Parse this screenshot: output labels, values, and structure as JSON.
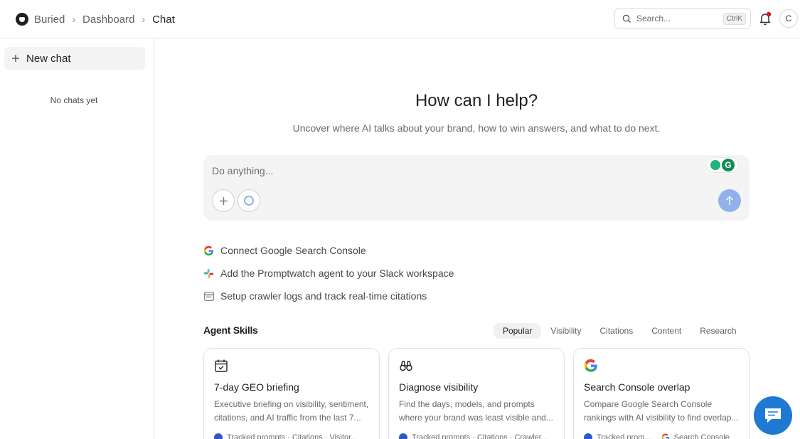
{
  "header": {
    "breadcrumb": [
      "Buried",
      "Dashboard",
      "Chat"
    ],
    "search_placeholder": "Search...",
    "search_shortcut": "CtrlK",
    "avatar_initial": "C"
  },
  "sidebar": {
    "new_chat_label": "New chat",
    "empty_text": "No chats yet"
  },
  "main": {
    "title": "How can I help?",
    "subtitle": "Uncover where AI talks about your brand, how to win answers, and what to do next.",
    "input_placeholder": "Do anything...",
    "quick_actions": [
      {
        "label": "Connect Google Search Console",
        "icon": "google-icon"
      },
      {
        "label": "Add the Promptwatch agent to your Slack workspace",
        "icon": "slack-icon"
      },
      {
        "label": "Setup crawler logs and track real-time citations",
        "icon": "terminal-icon"
      }
    ],
    "skills_title": "Agent Skills",
    "tabs": [
      "Popular",
      "Visibility",
      "Citations",
      "Content",
      "Research"
    ],
    "active_tab": "Popular",
    "cards": [
      {
        "icon": "calendar-check-icon",
        "title": "7-day GEO briefing",
        "desc": "Executive briefing on visibility, sentiment, citations, and AI traffic from the last 7...",
        "foot": "Tracked prompts · Citations · Visitor..."
      },
      {
        "icon": "binoculars-icon",
        "title": "Diagnose visibility",
        "desc": "Find the days, models, and prompts where your brand was least visible and...",
        "foot": "Tracked prompts · Citations · Crawler..."
      },
      {
        "icon": "google-icon",
        "title": "Search Console overlap",
        "desc": "Compare Google Search Console rankings with AI visibility to find overlap...",
        "foot": "Tracked prom...",
        "foot2": "Search Console"
      }
    ]
  },
  "colors": {
    "accent": "#90b1e9",
    "chat_widget": "#1f78d1",
    "notification": "#d11a1a"
  }
}
